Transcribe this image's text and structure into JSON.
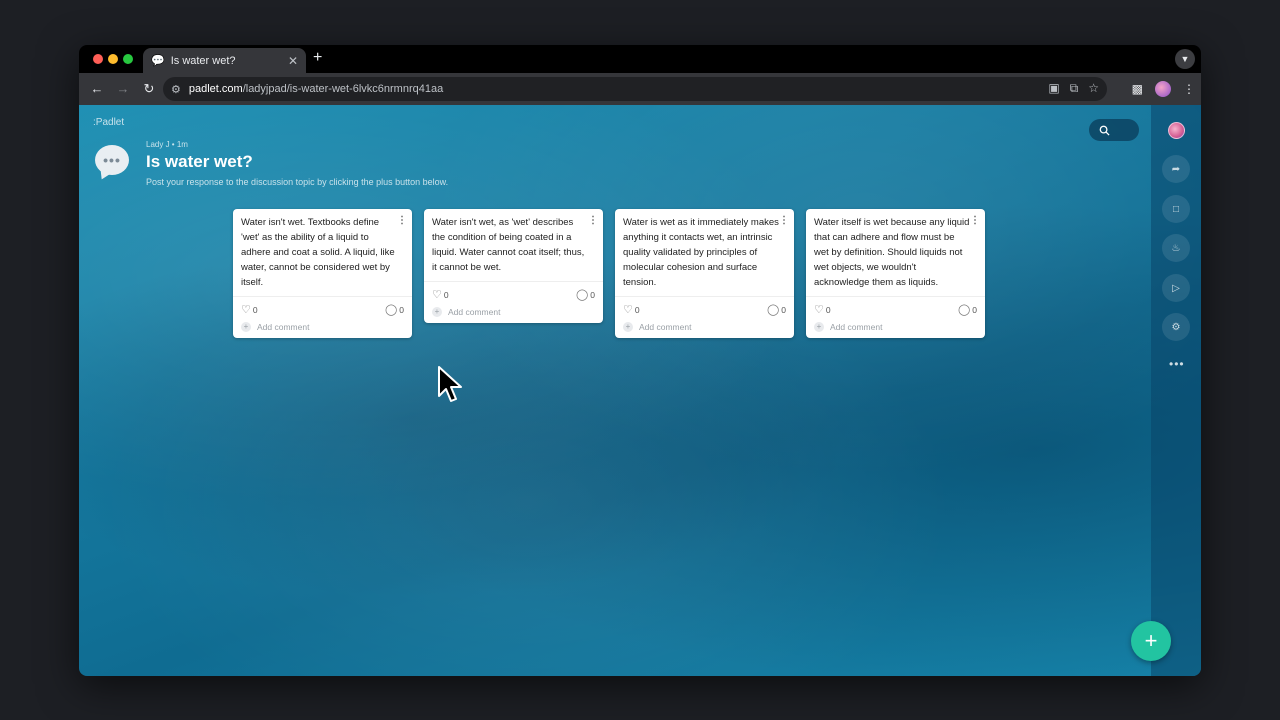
{
  "browser": {
    "tab_title": "Is water wet?",
    "tab_icon": "speech-bubble-icon",
    "new_tab": "+",
    "url_domain": "padlet.com",
    "url_path": "/ladyjpad/is-water-wet-6lvkc6nrmnrq41aa"
  },
  "padlet": {
    "brand": ":Padlet",
    "author": "Lady J • 1m",
    "title": "Is water wet?",
    "subtitle": "Post your response to the discussion topic by clicking the plus button below.",
    "search_icon": "search-icon",
    "more": "•••",
    "fab": "+"
  },
  "posts": [
    {
      "text": "Water isn't wet. Textbooks define 'wet' as the ability of a liquid to adhere and coat a solid. A liquid, like water, cannot be considered wet by itself.",
      "likes": "0",
      "comments": "0",
      "add_comment": "Add comment"
    },
    {
      "text": "Water isn't wet, as 'wet' describes the condition of being coated in a liquid. Water cannot coat itself; thus, it cannot be wet.",
      "likes": "0",
      "comments": "0",
      "add_comment": "Add comment"
    },
    {
      "text": "Water is wet as it immediately makes anything it contacts wet, an intrinsic quality validated by principles of molecular cohesion and surface tension.",
      "likes": "0",
      "comments": "0",
      "add_comment": "Add comment"
    },
    {
      "text": "Water itself is wet because any liquid that can adhere and flow must be wet by definition. Should liquids not wet objects, we wouldn't acknowledge them as liquids.",
      "likes": "0",
      "comments": "0",
      "add_comment": "Add comment"
    }
  ],
  "colors": {
    "fab": "#22c4a1",
    "ocean": "#167aa0"
  }
}
